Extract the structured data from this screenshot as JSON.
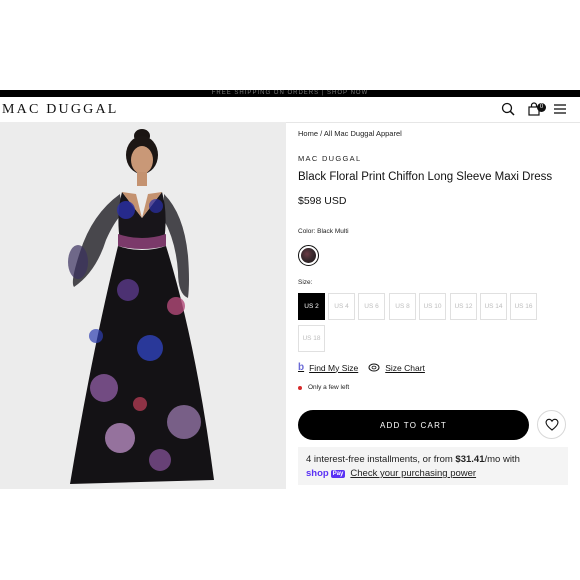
{
  "header": {
    "promo_text": "FREE SHIPPING ON ORDERS | SHOP NOW",
    "logo": "MAC DUGGAL",
    "cart_count": "0"
  },
  "breadcrumb": "Home / All Mac Duggal Apparel",
  "product": {
    "brand": "MAC DUGGAL",
    "title": "Black Floral Print Chiffon Long Sleeve Maxi Dress",
    "price": "$598 USD",
    "color_label": "Color: Black Multi",
    "size_label": "Size:",
    "sizes": [
      {
        "label": "US 2",
        "selected": true
      },
      {
        "label": "US 4",
        "available": false
      },
      {
        "label": "US 6",
        "available": false
      },
      {
        "label": "US 8",
        "available": false
      },
      {
        "label": "US 10",
        "available": false
      },
      {
        "label": "US 12",
        "available": false
      },
      {
        "label": "US 14",
        "available": false
      },
      {
        "label": "US 16",
        "available": false
      },
      {
        "label": "US 18",
        "available": false
      }
    ],
    "find_my_size": "Find My Size",
    "size_chart": "Size Chart",
    "stock_status": "Only a few left",
    "add_to_cart": "ADD TO CART"
  },
  "shoppay": {
    "line1_prefix": "4 interest-free installments, or from ",
    "line1_amount": "$31.41",
    "line1_suffix": "/mo with",
    "logo_text": "shop",
    "logo_pay": "Pay",
    "check_link": "Check your purchasing power"
  },
  "colors": {
    "accent": "#000000",
    "shoppay": "#5a31f4",
    "stock_dot": "#d62b2b"
  },
  "icons": {
    "search": "search-icon",
    "cart": "bag-icon",
    "menu": "hamburger-icon",
    "wishlist": "heart-icon",
    "find_my_size": "b-logo-icon",
    "size_chart": "tape-measure-icon"
  }
}
